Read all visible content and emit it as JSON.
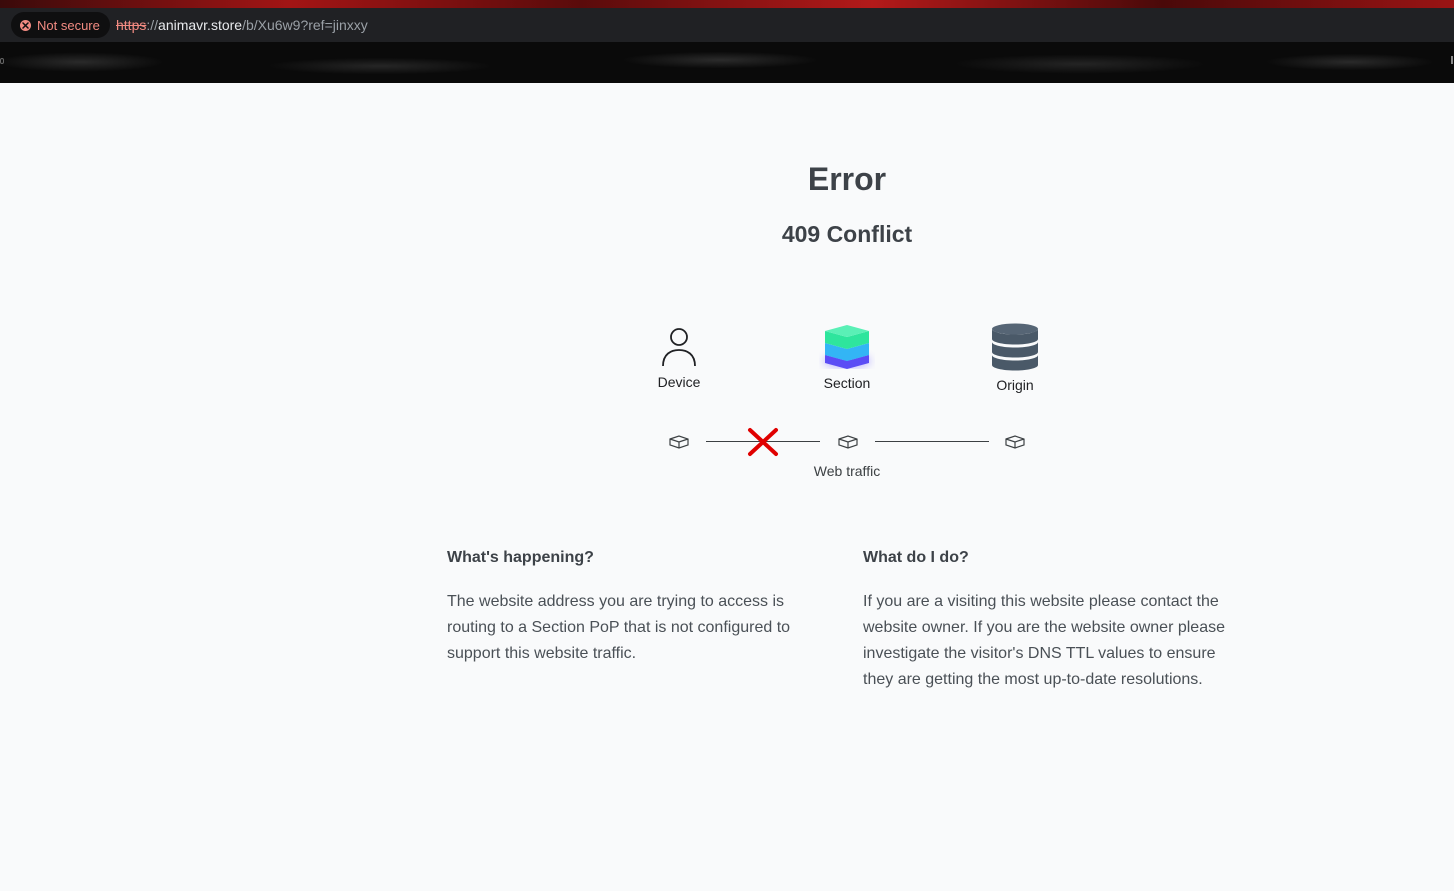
{
  "browser": {
    "security_label": "Not secure",
    "url_scheme": "https",
    "url_separator": "://",
    "url_host": "animavr.store",
    "url_path": "/b/Xu6w9?ref=jinxxy"
  },
  "page": {
    "title": "Error",
    "subtitle": "409 Conflict"
  },
  "diagram": {
    "device_label": "Device",
    "section_label": "Section",
    "origin_label": "Origin",
    "traffic_label": "Web traffic",
    "icons": {
      "device": "person-icon",
      "section": "stacked-layers-icon",
      "origin": "database-icon",
      "broken_link": "red-x-icon"
    },
    "colors": {
      "error_x": "#e00000",
      "section_top": "#2ee59d",
      "section_mid": "#33b5f5",
      "section_bottom": "#5b4cf5",
      "origin": "#4a5968"
    }
  },
  "info": {
    "happening_heading": "What's happening?",
    "happening_body": "The website address you are trying to access is routing to a Section PoP that is not configured to support this website traffic.",
    "todo_heading": "What do I do?",
    "todo_body": "If you are a visiting this website please contact the website owner. If you are the website owner please investigate the visitor's DNS TTL values to ensure they are getting the most up-to-date resolutions."
  }
}
